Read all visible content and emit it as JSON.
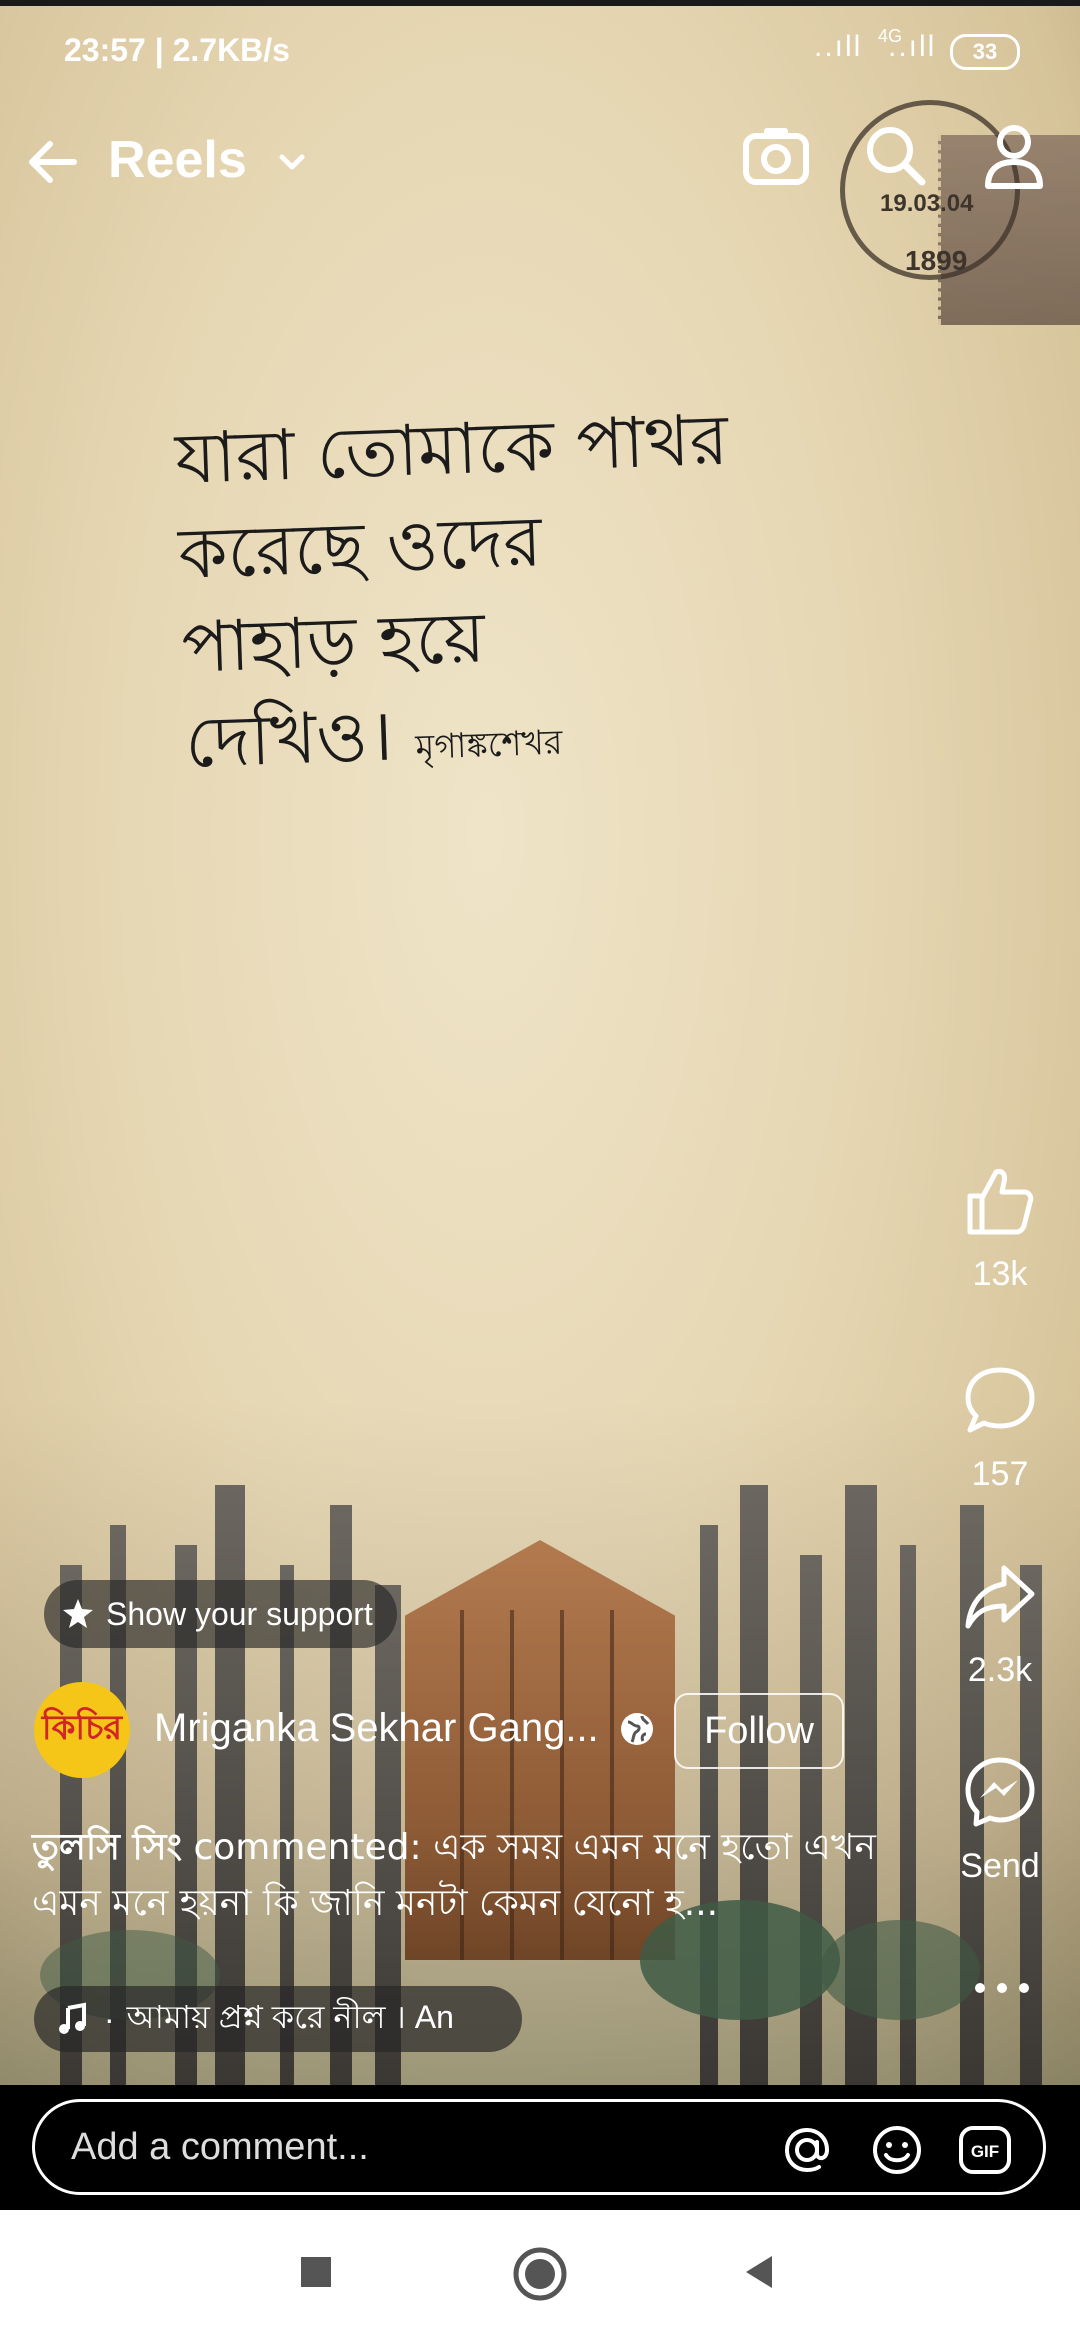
{
  "status_bar": {
    "time": "23:57 | 2.7KB/s",
    "signal": "..ıll",
    "network": "4G",
    "signal2": "..ıll",
    "battery": "33"
  },
  "header": {
    "title": "Reels"
  },
  "content": {
    "poem_lines": [
      "যারা তোমাকে পাথর",
      "করেছে ওদের",
      "পাহাড় হয়ে",
      "দেখিও।"
    ],
    "signature": "মৃগাঙ্কশেখর",
    "stamp_date": "19.03.04",
    "stamp_year": "1899"
  },
  "actions": {
    "likes": "13k",
    "comments": "157",
    "shares": "2.3k",
    "send_label": "Send"
  },
  "support": {
    "label": "Show your support"
  },
  "author": {
    "avatar_text": "কিচির",
    "name": "Mriganka Sekhar Gang...",
    "follow_label": "Follow"
  },
  "comment_preview": {
    "commenter": "তুলসি সিং",
    "text": " commented: এক সময় এমন মনে হতো এখন এমন মনে হয়না কি জানি মনটা কেমন যেনো হ..."
  },
  "music": {
    "label": "আমায় প্রশ্ন করে নীল । An"
  },
  "comment_input": {
    "placeholder": "Add a comment..."
  },
  "colors": {
    "accent_yellow": "#f5c518",
    "avatar_red": "#d12626"
  }
}
